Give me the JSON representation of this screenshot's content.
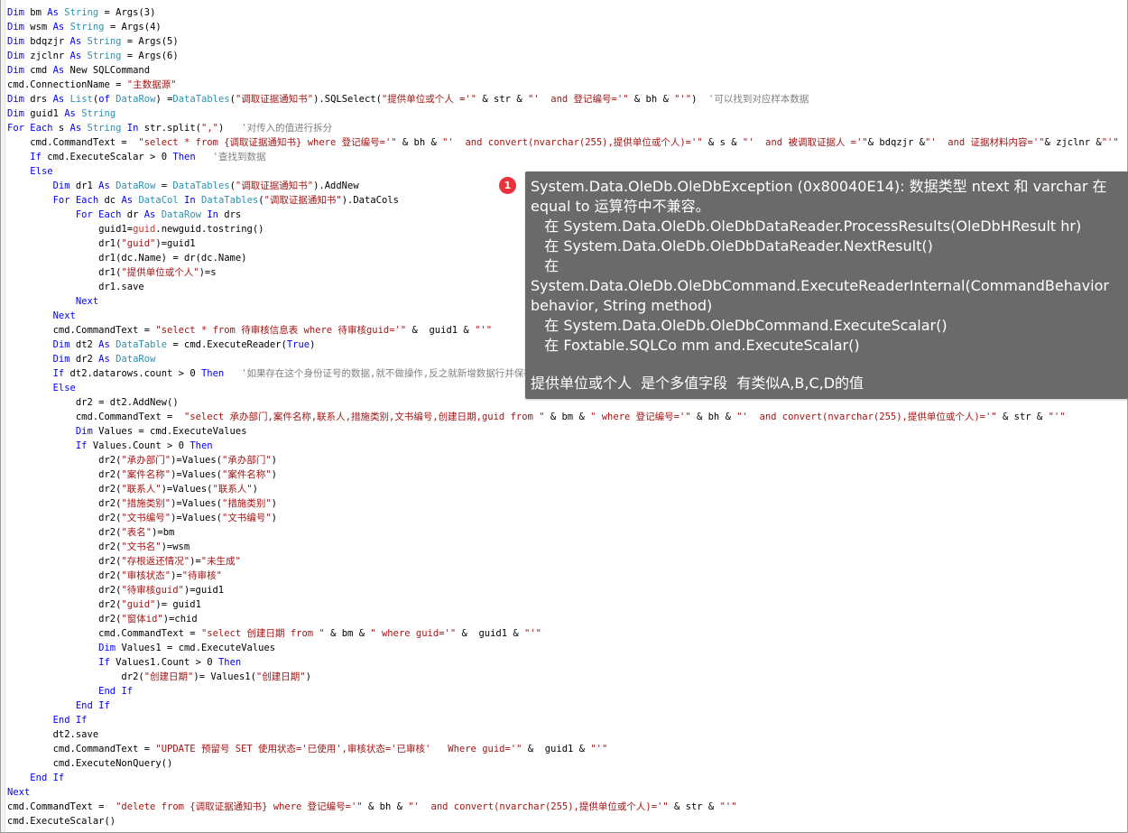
{
  "lines": [
    [
      [
        "kw",
        "Dim"
      ],
      [
        "pl",
        " bm "
      ],
      [
        "kw",
        "As"
      ],
      [
        "pl",
        " "
      ],
      [
        "ty",
        "String"
      ],
      [
        "pl",
        " = Args("
      ],
      [
        "nu",
        "3"
      ],
      [
        "pl",
        ")"
      ]
    ],
    [
      [
        "kw",
        "Dim"
      ],
      [
        "pl",
        " wsm "
      ],
      [
        "kw",
        "As"
      ],
      [
        "pl",
        " "
      ],
      [
        "ty",
        "String"
      ],
      [
        "pl",
        " = Args("
      ],
      [
        "nu",
        "4"
      ],
      [
        "pl",
        ")"
      ]
    ],
    [
      [
        "kw",
        "Dim"
      ],
      [
        "pl",
        " bdqzjr "
      ],
      [
        "kw",
        "As"
      ],
      [
        "pl",
        " "
      ],
      [
        "ty",
        "String"
      ],
      [
        "pl",
        " = Args("
      ],
      [
        "nu",
        "5"
      ],
      [
        "pl",
        ")"
      ]
    ],
    [
      [
        "kw",
        "Dim"
      ],
      [
        "pl",
        " zjclnr "
      ],
      [
        "kw",
        "As"
      ],
      [
        "pl",
        " "
      ],
      [
        "ty",
        "String"
      ],
      [
        "pl",
        " = Args("
      ],
      [
        "nu",
        "6"
      ],
      [
        "pl",
        ")"
      ]
    ],
    [
      [
        "kw",
        "Dim"
      ],
      [
        "pl",
        " cmd "
      ],
      [
        "kw",
        "As"
      ],
      [
        "pl",
        " New SQLCommand"
      ]
    ],
    [
      [
        "pl",
        "cmd.ConnectionName = "
      ],
      [
        "st",
        "\"主数据源\""
      ]
    ],
    [
      [
        "kw",
        "Dim"
      ],
      [
        "pl",
        " drs "
      ],
      [
        "kw",
        "As"
      ],
      [
        "pl",
        " "
      ],
      [
        "ty",
        "List"
      ],
      [
        "pl",
        "("
      ],
      [
        "kw",
        "of"
      ],
      [
        "pl",
        " "
      ],
      [
        "ty",
        "DataRow"
      ],
      [
        "pl",
        ") ="
      ],
      [
        "ty",
        "DataTables"
      ],
      [
        "pl",
        "("
      ],
      [
        "st",
        "\"调取证据通知书\""
      ],
      [
        "pl",
        ").SQLSelect("
      ],
      [
        "st",
        "\"提供单位或个人 ='\""
      ],
      [
        "pl",
        " & str & "
      ],
      [
        "st",
        "\"'  and 登记编号='\""
      ],
      [
        "pl",
        " & bh & "
      ],
      [
        "st",
        "\"'\""
      ],
      [
        "pl",
        ")  "
      ],
      [
        "cm",
        "'可以找到对应样本数据"
      ]
    ],
    [
      [
        "kw",
        "Dim"
      ],
      [
        "pl",
        " guid1 "
      ],
      [
        "kw",
        "As"
      ],
      [
        "pl",
        " "
      ],
      [
        "ty",
        "String"
      ]
    ],
    [
      [
        "kw",
        "For Each"
      ],
      [
        "pl",
        " s "
      ],
      [
        "kw",
        "As"
      ],
      [
        "pl",
        " "
      ],
      [
        "ty",
        "String"
      ],
      [
        "pl",
        " "
      ],
      [
        "kw",
        "In"
      ],
      [
        "pl",
        " str.split("
      ],
      [
        "st",
        "\",\""
      ],
      [
        "pl",
        ")   "
      ],
      [
        "cm",
        "'对传入的值进行拆分"
      ]
    ],
    [
      [
        "pl",
        "    cmd.CommandText =  "
      ],
      [
        "st",
        "\"select * from {调取证据通知书} where 登记编号='\""
      ],
      [
        "pl",
        " & bh & "
      ],
      [
        "st",
        "\"'  and convert(nvarchar(255),提供单位或个人)='\""
      ],
      [
        "pl",
        " & s & "
      ],
      [
        "st",
        "\"'  and 被调取证据人 ='\""
      ],
      [
        "pl",
        "& bdqzjr &"
      ],
      [
        "st",
        "\"'  and 证据材料内容='\""
      ],
      [
        "pl",
        "& zjclnr &"
      ],
      [
        "st",
        "\"'\""
      ]
    ],
    [
      [
        "pl",
        "    "
      ],
      [
        "kw",
        "If"
      ],
      [
        "pl",
        " cmd.ExecuteScalar > "
      ],
      [
        "nu",
        "0"
      ],
      [
        "pl",
        " "
      ],
      [
        "kw",
        "Then"
      ],
      [
        "pl",
        "   "
      ],
      [
        "cm",
        "'查找到数据"
      ]
    ],
    [
      [
        "pl",
        "    "
      ],
      [
        "kw",
        "Else"
      ]
    ],
    [
      [
        "pl",
        "        "
      ],
      [
        "kw",
        "Dim"
      ],
      [
        "pl",
        " dr1 "
      ],
      [
        "kw",
        "As"
      ],
      [
        "pl",
        " "
      ],
      [
        "ty",
        "DataRow"
      ],
      [
        "pl",
        " = "
      ],
      [
        "ty",
        "DataTables"
      ],
      [
        "pl",
        "("
      ],
      [
        "st",
        "\"调取证据通知书\""
      ],
      [
        "pl",
        ").AddNew"
      ]
    ],
    [
      [
        "pl",
        "        "
      ],
      [
        "kw",
        "For Each"
      ],
      [
        "pl",
        " dc "
      ],
      [
        "kw",
        "As"
      ],
      [
        "pl",
        " "
      ],
      [
        "ty",
        "DataCol"
      ],
      [
        "pl",
        " "
      ],
      [
        "kw",
        "In"
      ],
      [
        "pl",
        " "
      ],
      [
        "ty",
        "DataTables"
      ],
      [
        "pl",
        "("
      ],
      [
        "st",
        "\"调取证据通知书\""
      ],
      [
        "pl",
        ").DataCols"
      ]
    ],
    [
      [
        "pl",
        "            "
      ],
      [
        "kw",
        "For Each"
      ],
      [
        "pl",
        " dr "
      ],
      [
        "kw",
        "As"
      ],
      [
        "pl",
        " "
      ],
      [
        "ty",
        "DataRow"
      ],
      [
        "pl",
        " "
      ],
      [
        "kw",
        "In"
      ],
      [
        "pl",
        " drs"
      ]
    ],
    [
      [
        "pl",
        "                guid1="
      ],
      [
        "fn",
        "guid"
      ],
      [
        "pl",
        ".newguid.tostring()"
      ]
    ],
    [
      [
        "pl",
        "                dr1("
      ],
      [
        "st",
        "\"guid\""
      ],
      [
        "pl",
        ")=guid1"
      ]
    ],
    [
      [
        "pl",
        "                dr1(dc.Name) = dr(dc.Name)"
      ]
    ],
    [
      [
        "pl",
        "                dr1("
      ],
      [
        "st",
        "\"提供单位或个人\""
      ],
      [
        "pl",
        ")=s"
      ]
    ],
    [
      [
        "pl",
        "                dr1.save"
      ]
    ],
    [
      [
        "pl",
        "            "
      ],
      [
        "kw",
        "Next"
      ]
    ],
    [
      [
        "pl",
        "        "
      ],
      [
        "kw",
        "Next"
      ]
    ],
    [
      [
        "pl",
        "        cmd.CommandText = "
      ],
      [
        "st",
        "\"select * from 待审核信息表 where 待审核guid='\""
      ],
      [
        "pl",
        " &  guid1 & "
      ],
      [
        "st",
        "\"'\""
      ]
    ],
    [
      [
        "pl",
        "        "
      ],
      [
        "kw",
        "Dim"
      ],
      [
        "pl",
        " dt2 "
      ],
      [
        "kw",
        "As"
      ],
      [
        "pl",
        " "
      ],
      [
        "ty",
        "DataTable"
      ],
      [
        "pl",
        " = cmd.ExecuteReader("
      ],
      [
        "kw",
        "True"
      ],
      [
        "pl",
        ")"
      ]
    ],
    [
      [
        "pl",
        "        "
      ],
      [
        "kw",
        "Dim"
      ],
      [
        "pl",
        " dr2 "
      ],
      [
        "kw",
        "As"
      ],
      [
        "pl",
        " "
      ],
      [
        "ty",
        "DataRow"
      ]
    ],
    [
      [
        "pl",
        "        "
      ],
      [
        "kw",
        "If"
      ],
      [
        "pl",
        " dt2.datarows.count > "
      ],
      [
        "nu",
        "0"
      ],
      [
        "pl",
        " "
      ],
      [
        "kw",
        "Then"
      ],
      [
        "pl",
        "   "
      ],
      [
        "cm",
        "'如果存在这个身份证号的数据,就不做操作,反之就新增数据行并保存"
      ]
    ],
    [
      [
        "pl",
        "        "
      ],
      [
        "kw",
        "Else"
      ]
    ],
    [
      [
        "pl",
        "            dr2 = dt2.AddNew()"
      ]
    ],
    [
      [
        "pl",
        "            cmd.CommandText =  "
      ],
      [
        "st",
        "\"select 承办部门,案件名称,联系人,措施类别,文书编号,创建日期,guid from \""
      ],
      [
        "pl",
        " & bm & "
      ],
      [
        "st",
        "\" where 登记编号='\""
      ],
      [
        "pl",
        " & bh & "
      ],
      [
        "st",
        "\"'  and convert(nvarchar(255),提供单位或个人)='\""
      ],
      [
        "pl",
        " & str & "
      ],
      [
        "st",
        "\"'\""
      ]
    ],
    [
      [
        "pl",
        "            "
      ],
      [
        "kw",
        "Dim"
      ],
      [
        "pl",
        " Values = cmd.ExecuteValues"
      ]
    ],
    [
      [
        "pl",
        "            "
      ],
      [
        "kw",
        "If"
      ],
      [
        "pl",
        " Values.Count > "
      ],
      [
        "nu",
        "0"
      ],
      [
        "pl",
        " "
      ],
      [
        "kw",
        "Then"
      ]
    ],
    [
      [
        "pl",
        "                dr2("
      ],
      [
        "st",
        "\"承办部门\""
      ],
      [
        "pl",
        ")=Values("
      ],
      [
        "st",
        "\"承办部门\""
      ],
      [
        "pl",
        ")"
      ]
    ],
    [
      [
        "pl",
        "                dr2("
      ],
      [
        "st",
        "\"案件名称\""
      ],
      [
        "pl",
        ")=Values("
      ],
      [
        "st",
        "\"案件名称\""
      ],
      [
        "pl",
        ")"
      ]
    ],
    [
      [
        "pl",
        "                dr2("
      ],
      [
        "st",
        "\"联系人\""
      ],
      [
        "pl",
        ")=Values("
      ],
      [
        "st",
        "\"联系人\""
      ],
      [
        "pl",
        ")"
      ]
    ],
    [
      [
        "pl",
        "                dr2("
      ],
      [
        "st",
        "\"措施类别\""
      ],
      [
        "pl",
        ")=Values("
      ],
      [
        "st",
        "\"措施类别\""
      ],
      [
        "pl",
        ")"
      ]
    ],
    [
      [
        "pl",
        "                dr2("
      ],
      [
        "st",
        "\"文书编号\""
      ],
      [
        "pl",
        ")=Values("
      ],
      [
        "st",
        "\"文书编号\""
      ],
      [
        "pl",
        ")"
      ]
    ],
    [
      [
        "pl",
        "                dr2("
      ],
      [
        "st",
        "\"表名\""
      ],
      [
        "pl",
        ")=bm"
      ]
    ],
    [
      [
        "pl",
        "                dr2("
      ],
      [
        "st",
        "\"文书名\""
      ],
      [
        "pl",
        ")=wsm"
      ]
    ],
    [
      [
        "pl",
        "                dr2("
      ],
      [
        "st",
        "\"存根返还情况\""
      ],
      [
        "pl",
        ")="
      ],
      [
        "st",
        "\"未生成\""
      ]
    ],
    [
      [
        "pl",
        "                dr2("
      ],
      [
        "st",
        "\"审核状态\""
      ],
      [
        "pl",
        ")="
      ],
      [
        "st",
        "\"待审核\""
      ]
    ],
    [
      [
        "pl",
        "                dr2("
      ],
      [
        "st",
        "\"待审核guid\""
      ],
      [
        "pl",
        ")=guid1"
      ]
    ],
    [
      [
        "pl",
        "                dr2("
      ],
      [
        "st",
        "\"guid\""
      ],
      [
        "pl",
        ")= guid1"
      ]
    ],
    [
      [
        "pl",
        "                dr2("
      ],
      [
        "st",
        "\"窗体id\""
      ],
      [
        "pl",
        ")=chid"
      ]
    ],
    [
      [
        "pl",
        "                cmd.CommandText = "
      ],
      [
        "st",
        "\"select 创建日期 from \""
      ],
      [
        "pl",
        " & bm & "
      ],
      [
        "st",
        "\" where guid='\""
      ],
      [
        "pl",
        " &  guid1 & "
      ],
      [
        "st",
        "\"'\""
      ]
    ],
    [
      [
        "pl",
        "                "
      ],
      [
        "kw",
        "Dim"
      ],
      [
        "pl",
        " Values1 = cmd.ExecuteValues"
      ]
    ],
    [
      [
        "pl",
        "                "
      ],
      [
        "kw",
        "If"
      ],
      [
        "pl",
        " Values1.Count > "
      ],
      [
        "nu",
        "0"
      ],
      [
        "pl",
        " "
      ],
      [
        "kw",
        "Then"
      ]
    ],
    [
      [
        "pl",
        "                    dr2("
      ],
      [
        "st",
        "\"创建日期\""
      ],
      [
        "pl",
        ")= Values1("
      ],
      [
        "st",
        "\"创建日期\""
      ],
      [
        "pl",
        ")"
      ]
    ],
    [
      [
        "pl",
        "                "
      ],
      [
        "kw",
        "End If"
      ]
    ],
    [
      [
        "pl",
        "            "
      ],
      [
        "kw",
        "End If"
      ]
    ],
    [
      [
        "pl",
        "        "
      ],
      [
        "kw",
        "End If"
      ]
    ],
    [
      [
        "pl",
        "        dt2.save"
      ]
    ],
    [
      [
        "pl",
        "        cmd.CommandText = "
      ],
      [
        "st",
        "\"UPDATE 预留号 SET 使用状态='已使用',审核状态='已审核'   Where guid='\""
      ],
      [
        "pl",
        " &  guid1 & "
      ],
      [
        "st",
        "\"'\""
      ]
    ],
    [
      [
        "pl",
        "        cmd.ExecuteNonQuery()"
      ]
    ],
    [
      [
        "pl",
        "    "
      ],
      [
        "kw",
        "End If"
      ]
    ],
    [
      [
        "kw",
        "Next"
      ]
    ],
    [
      [
        "pl",
        "cmd.CommandText =  "
      ],
      [
        "st",
        "\"delete from {调取证据通知书} where 登记编号='\""
      ],
      [
        "pl",
        " & bh & "
      ],
      [
        "st",
        "\"'  and convert(nvarchar(255),提供单位或个人)='\""
      ],
      [
        "pl",
        " & str & "
      ],
      [
        "st",
        "\"'\""
      ]
    ],
    [
      [
        "pl",
        "cmd.ExecuteScalar()"
      ]
    ]
  ],
  "tooltip": {
    "badge": "1",
    "lines": [
      "System.Data.OleDb.OleDbException (0x80040E14): 数据类型 ntext 和 varchar 在 equal to 运算符中不兼容。",
      "   在 System.Data.OleDb.OleDbDataReader.ProcessResults(OleDbHResult hr)",
      "   在 System.Data.OleDb.OleDbDataReader.NextResult()",
      "   在 System.Data.OleDb.OleDbCommand.ExecuteReaderInternal(CommandBehavior behavior, String method)",
      "   在 System.Data.OleDb.OleDbCommand.ExecuteScalar()",
      "   在 Foxtable.SQLCo mm and.ExecuteScalar()"
    ],
    "note": "提供单位或个人  是个多值字段  有类似A,B,C,D的值"
  }
}
